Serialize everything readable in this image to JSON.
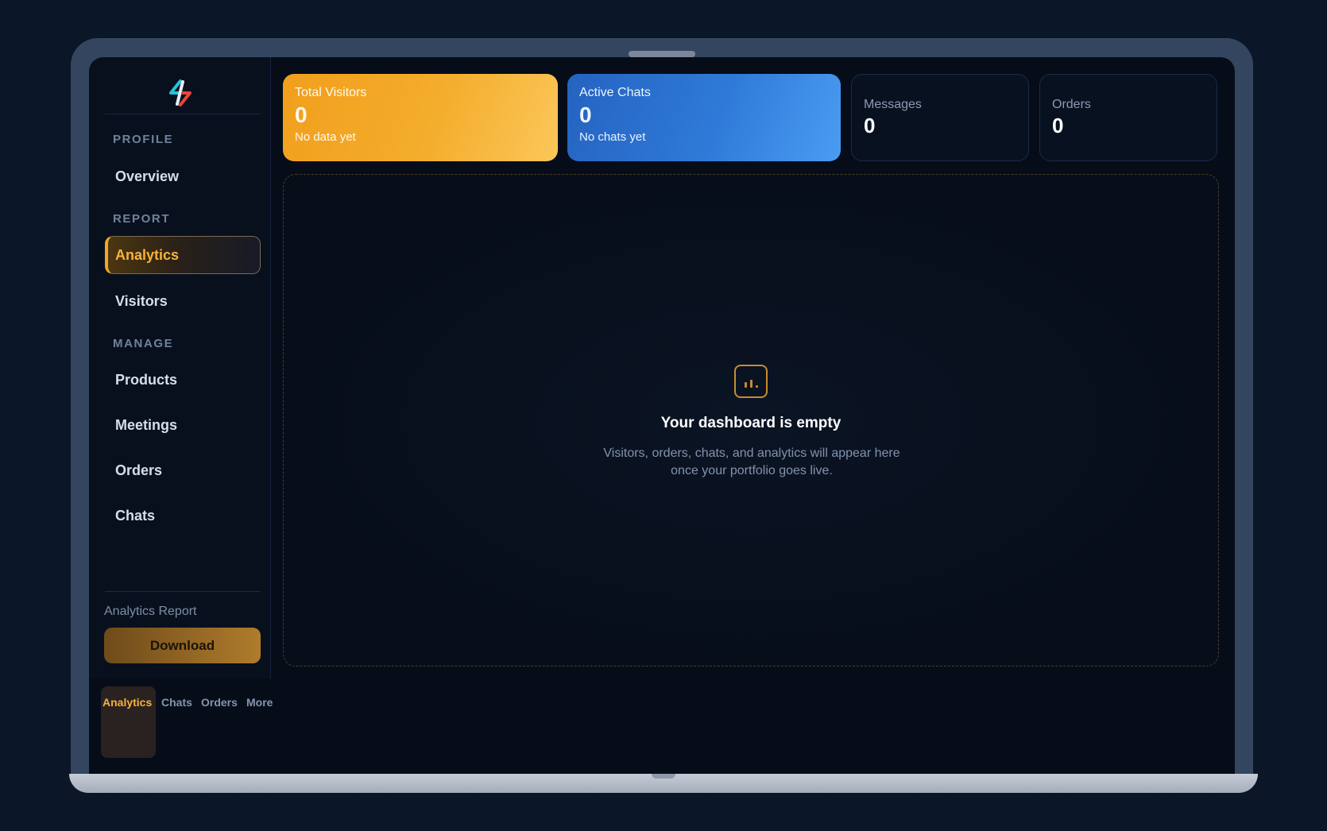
{
  "sidebar": {
    "sections": [
      {
        "label": "PROFILE",
        "items": [
          {
            "label": "Overview"
          }
        ]
      },
      {
        "label": "REPORT",
        "items": [
          {
            "label": "Analytics",
            "active": true
          },
          {
            "label": "Visitors"
          }
        ]
      },
      {
        "label": "MANAGE",
        "items": [
          {
            "label": "Products"
          },
          {
            "label": "Meetings"
          },
          {
            "label": "Orders"
          },
          {
            "label": "Chats"
          }
        ]
      }
    ],
    "report_label": "Analytics Report",
    "download_label": "Download"
  },
  "bottom_tabs": [
    {
      "label": "Analytics",
      "active": true
    },
    {
      "label": "Chats"
    },
    {
      "label": "Orders"
    },
    {
      "label": "More"
    }
  ],
  "stats": {
    "visitors": {
      "label": "Total Visitors",
      "value": "0",
      "sub": "No data yet"
    },
    "chats": {
      "label": "Active Chats",
      "value": "0",
      "sub": "No chats yet"
    },
    "messages": {
      "label": "Messages",
      "value": "0"
    },
    "orders": {
      "label": "Orders",
      "value": "0"
    }
  },
  "empty_state": {
    "icon": "bar-chart-icon",
    "title": "Your dashboard is empty",
    "description": "Visitors, orders, chats, and analytics will appear here once your portfolio goes live."
  },
  "colors": {
    "accent": "#f5a623",
    "blue": "#3b8ce8",
    "background": "#060d19"
  }
}
